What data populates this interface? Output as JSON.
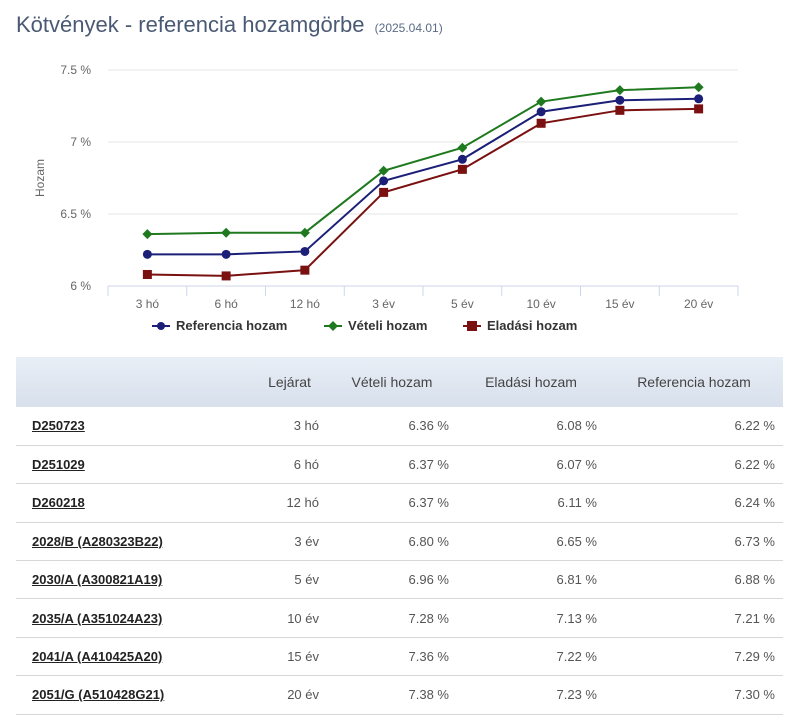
{
  "header": {
    "title": "Kötvények - referencia hozamgörbe",
    "date": "(2025.04.01)"
  },
  "chart_data": {
    "type": "line",
    "ylabel": "Hozam",
    "categories": [
      "3 hó",
      "6 hó",
      "12 hó",
      "3 év",
      "5 év",
      "10 év",
      "15 év",
      "20 év"
    ],
    "yticks": [
      "6 %",
      "6.5 %",
      "7 %",
      "7.5 %"
    ],
    "ylim": [
      6,
      7.5
    ],
    "grid": true,
    "legend_position": "bottom",
    "series": [
      {
        "name": "Referencia hozam",
        "color": "#1b1f78",
        "marker": "circle",
        "values": [
          6.22,
          6.22,
          6.24,
          6.73,
          6.88,
          7.21,
          7.29,
          7.3
        ]
      },
      {
        "name": "Vételi hozam",
        "color": "#1f7a1f",
        "marker": "diamond",
        "values": [
          6.36,
          6.37,
          6.37,
          6.8,
          6.96,
          7.28,
          7.36,
          7.38
        ]
      },
      {
        "name": "Eladási hozam",
        "color": "#7a1010",
        "marker": "square",
        "values": [
          6.08,
          6.07,
          6.11,
          6.65,
          6.81,
          7.13,
          7.22,
          7.23
        ]
      }
    ]
  },
  "table": {
    "headers": [
      "",
      "Lejárat",
      "Vételi hozam",
      "Eladási hozam",
      "Referencia hozam"
    ],
    "rows": [
      {
        "name": "D250723",
        "maturity": "3 hó",
        "buy": "6.36 %",
        "sell": "6.08 %",
        "ref": "6.22 %"
      },
      {
        "name": "D251029",
        "maturity": "6 hó",
        "buy": "6.37 %",
        "sell": "6.07 %",
        "ref": "6.22 %"
      },
      {
        "name": "D260218",
        "maturity": "12 hó",
        "buy": "6.37 %",
        "sell": "6.11 %",
        "ref": "6.24 %"
      },
      {
        "name": "2028/B (A280323B22)",
        "maturity": "3 év",
        "buy": "6.80 %",
        "sell": "6.65 %",
        "ref": "6.73 %"
      },
      {
        "name": "2030/A (A300821A19)",
        "maturity": "5 év",
        "buy": "6.96 %",
        "sell": "6.81 %",
        "ref": "6.88 %"
      },
      {
        "name": "2035/A (A351024A23)",
        "maturity": "10 év",
        "buy": "7.28 %",
        "sell": "7.13 %",
        "ref": "7.21 %"
      },
      {
        "name": "2041/A (A410425A20)",
        "maturity": "15 év",
        "buy": "7.36 %",
        "sell": "7.22 %",
        "ref": "7.29 %"
      },
      {
        "name": "2051/G (A510428G21)",
        "maturity": "20 év",
        "buy": "7.38 %",
        "sell": "7.23 %",
        "ref": "7.30 %"
      }
    ]
  }
}
